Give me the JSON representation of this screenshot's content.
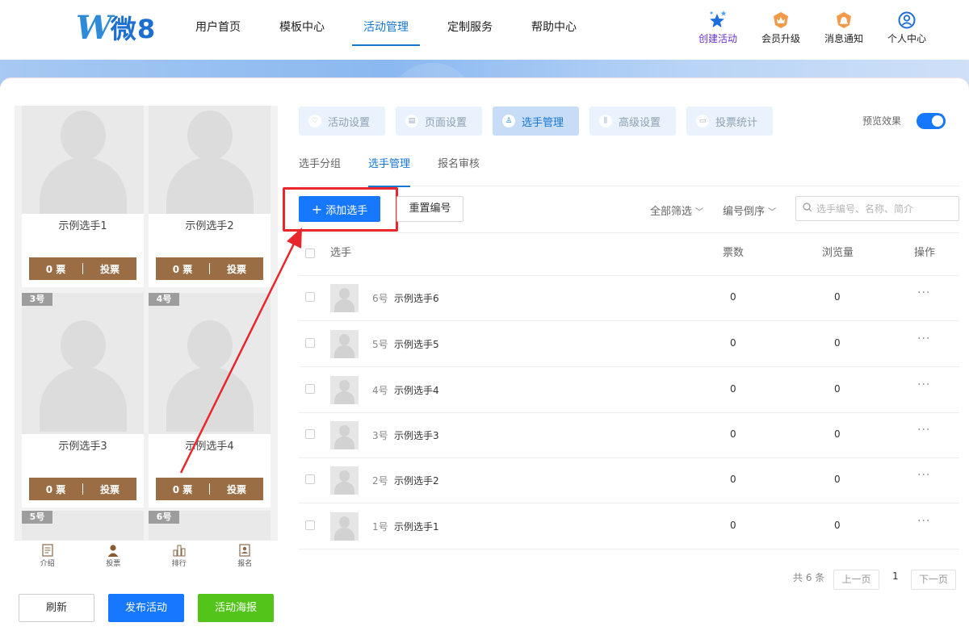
{
  "nav": {
    "logo_mark": "W",
    "logo_text": "微8",
    "items": [
      {
        "label": "用户首页"
      },
      {
        "label": "模板中心"
      },
      {
        "label": "活动管理"
      },
      {
        "label": "定制服务"
      },
      {
        "label": "帮助中心"
      }
    ],
    "active_index": 2,
    "tools": [
      {
        "label": "创建活动",
        "icon": "stars-icon"
      },
      {
        "label": "会员升级",
        "icon": "crown-badge-icon"
      },
      {
        "label": "消息通知",
        "icon": "bell-badge-icon"
      },
      {
        "label": "个人中心",
        "icon": "user-circle-icon"
      }
    ]
  },
  "preview": {
    "cards": [
      {
        "name": "示例选手1",
        "badge": "",
        "vote_count": "0 票",
        "vote_label": "投票"
      },
      {
        "name": "示例选手2",
        "badge": "",
        "vote_count": "0 票",
        "vote_label": "投票"
      },
      {
        "name": "示例选手3",
        "badge": "3号",
        "vote_count": "0 票",
        "vote_label": "投票"
      },
      {
        "name": "示例选手4",
        "badge": "4号",
        "vote_count": "0 票",
        "vote_label": "投票"
      }
    ],
    "extra_badges": [
      "5号",
      "6号"
    ],
    "tabbar": [
      {
        "label": "介绍",
        "icon": "document-icon"
      },
      {
        "label": "投票",
        "icon": "person-icon"
      },
      {
        "label": "排行",
        "icon": "bar-chart-icon"
      },
      {
        "label": "报名",
        "icon": "signup-icon"
      }
    ],
    "buttons": {
      "refresh": "刷新",
      "publish": "发布活动",
      "poster": "活动海报"
    }
  },
  "steps": [
    {
      "label": "活动设置"
    },
    {
      "label": "页面设置"
    },
    {
      "label": "选手管理"
    },
    {
      "label": "高级设置"
    },
    {
      "label": "投票统计"
    }
  ],
  "active_step": 2,
  "preview_toggle": {
    "label": "预览效果",
    "on": true
  },
  "subtabs": [
    {
      "label": "选手分组"
    },
    {
      "label": "选手管理"
    },
    {
      "label": "报名审核"
    }
  ],
  "toolbar": {
    "add_label": "添加选手",
    "renumber_label": "重置编号",
    "filter_all": "全部筛选",
    "sort_label": "编号倒序",
    "search_placeholder": "选手编号、名称、简介"
  },
  "table": {
    "headers": {
      "player": "选手",
      "votes": "票数",
      "views": "浏览量",
      "actions": "操作"
    },
    "rows": [
      {
        "num": "6号",
        "name": "示例选手6",
        "votes": "0",
        "views": "0"
      },
      {
        "num": "5号",
        "name": "示例选手5",
        "votes": "0",
        "views": "0"
      },
      {
        "num": "4号",
        "name": "示例选手4",
        "votes": "0",
        "views": "0"
      },
      {
        "num": "3号",
        "name": "示例选手3",
        "votes": "0",
        "views": "0"
      },
      {
        "num": "2号",
        "name": "示例选手2",
        "votes": "0",
        "views": "0"
      },
      {
        "num": "1号",
        "name": "示例选手1",
        "votes": "0",
        "views": "0"
      }
    ]
  },
  "pagination": {
    "total": "共 6 条",
    "prev": "上一页",
    "current": "1",
    "next": "下一页"
  },
  "colors": {
    "accent": "#1677ff",
    "vote_button": "#9a6d45",
    "highlight": "#e8262b",
    "poster": "#52c41a"
  }
}
